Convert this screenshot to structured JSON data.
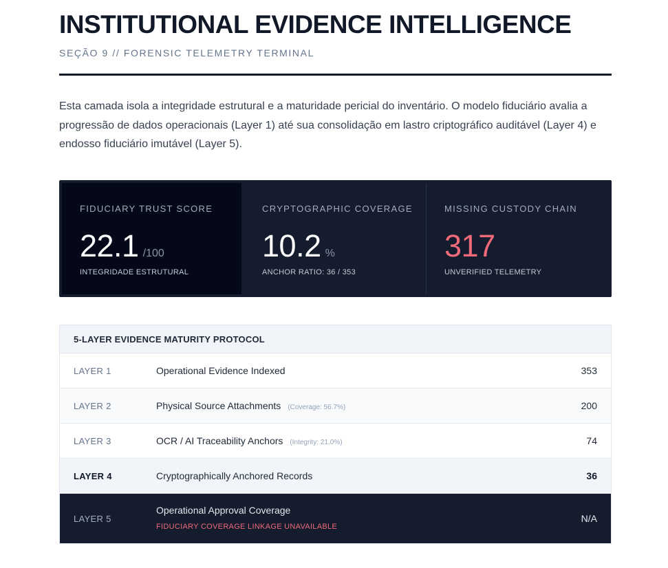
{
  "header": {
    "title": "INSTITUTIONAL EVIDENCE INTELLIGENCE",
    "subtitle": "SEÇÃO 9 // FORENSIC TELEMETRY TERMINAL"
  },
  "intro": "Esta camada isola a integridade estrutural e a maturidade pericial do inventário. O modelo fiduciário avalia a progressão de dados operacionais (Layer 1) até sua consolidação em lastro criptográfico auditável (Layer 4) e endosso fiduciário imutável (Layer 5).",
  "metrics": [
    {
      "label": "FIDUCIARY TRUST SCORE",
      "value": "22.1",
      "unit": "/100",
      "sub": "INTEGRIDADE ESTRUTURAL"
    },
    {
      "label": "CRYPTOGRAPHIC COVERAGE",
      "value": "10.2",
      "unit": "%",
      "sub": "ANCHOR RATIO: 36 / 353"
    },
    {
      "label": "MISSING CUSTODY CHAIN",
      "value": "317",
      "unit": "",
      "sub": "UNVERIFIED TELEMETRY"
    }
  ],
  "colors": {
    "dark_panel": "#141c2e",
    "alert": "#f06a7a"
  },
  "protocol": {
    "title": "5-LAYER EVIDENCE MATURITY PROTOCOL",
    "rows": [
      {
        "layer": "LAYER 1",
        "desc": "Operational Evidence Indexed",
        "note": "",
        "value": "353"
      },
      {
        "layer": "LAYER 2",
        "desc": "Physical Source Attachments",
        "note": "(Coverage: 56.7%)",
        "value": "200"
      },
      {
        "layer": "LAYER 3",
        "desc": "OCR / AI Traceability Anchors",
        "note": "(Integrity: 21.0%)",
        "value": "74"
      },
      {
        "layer": "LAYER 4",
        "desc": "Cryptographically Anchored Records",
        "note": "",
        "value": "36"
      },
      {
        "layer": "LAYER 5",
        "desc": "Operational Approval Coverage",
        "warning": "FIDUCIARY COVERAGE LINKAGE UNAVAILABLE",
        "value": "N/A"
      }
    ]
  }
}
